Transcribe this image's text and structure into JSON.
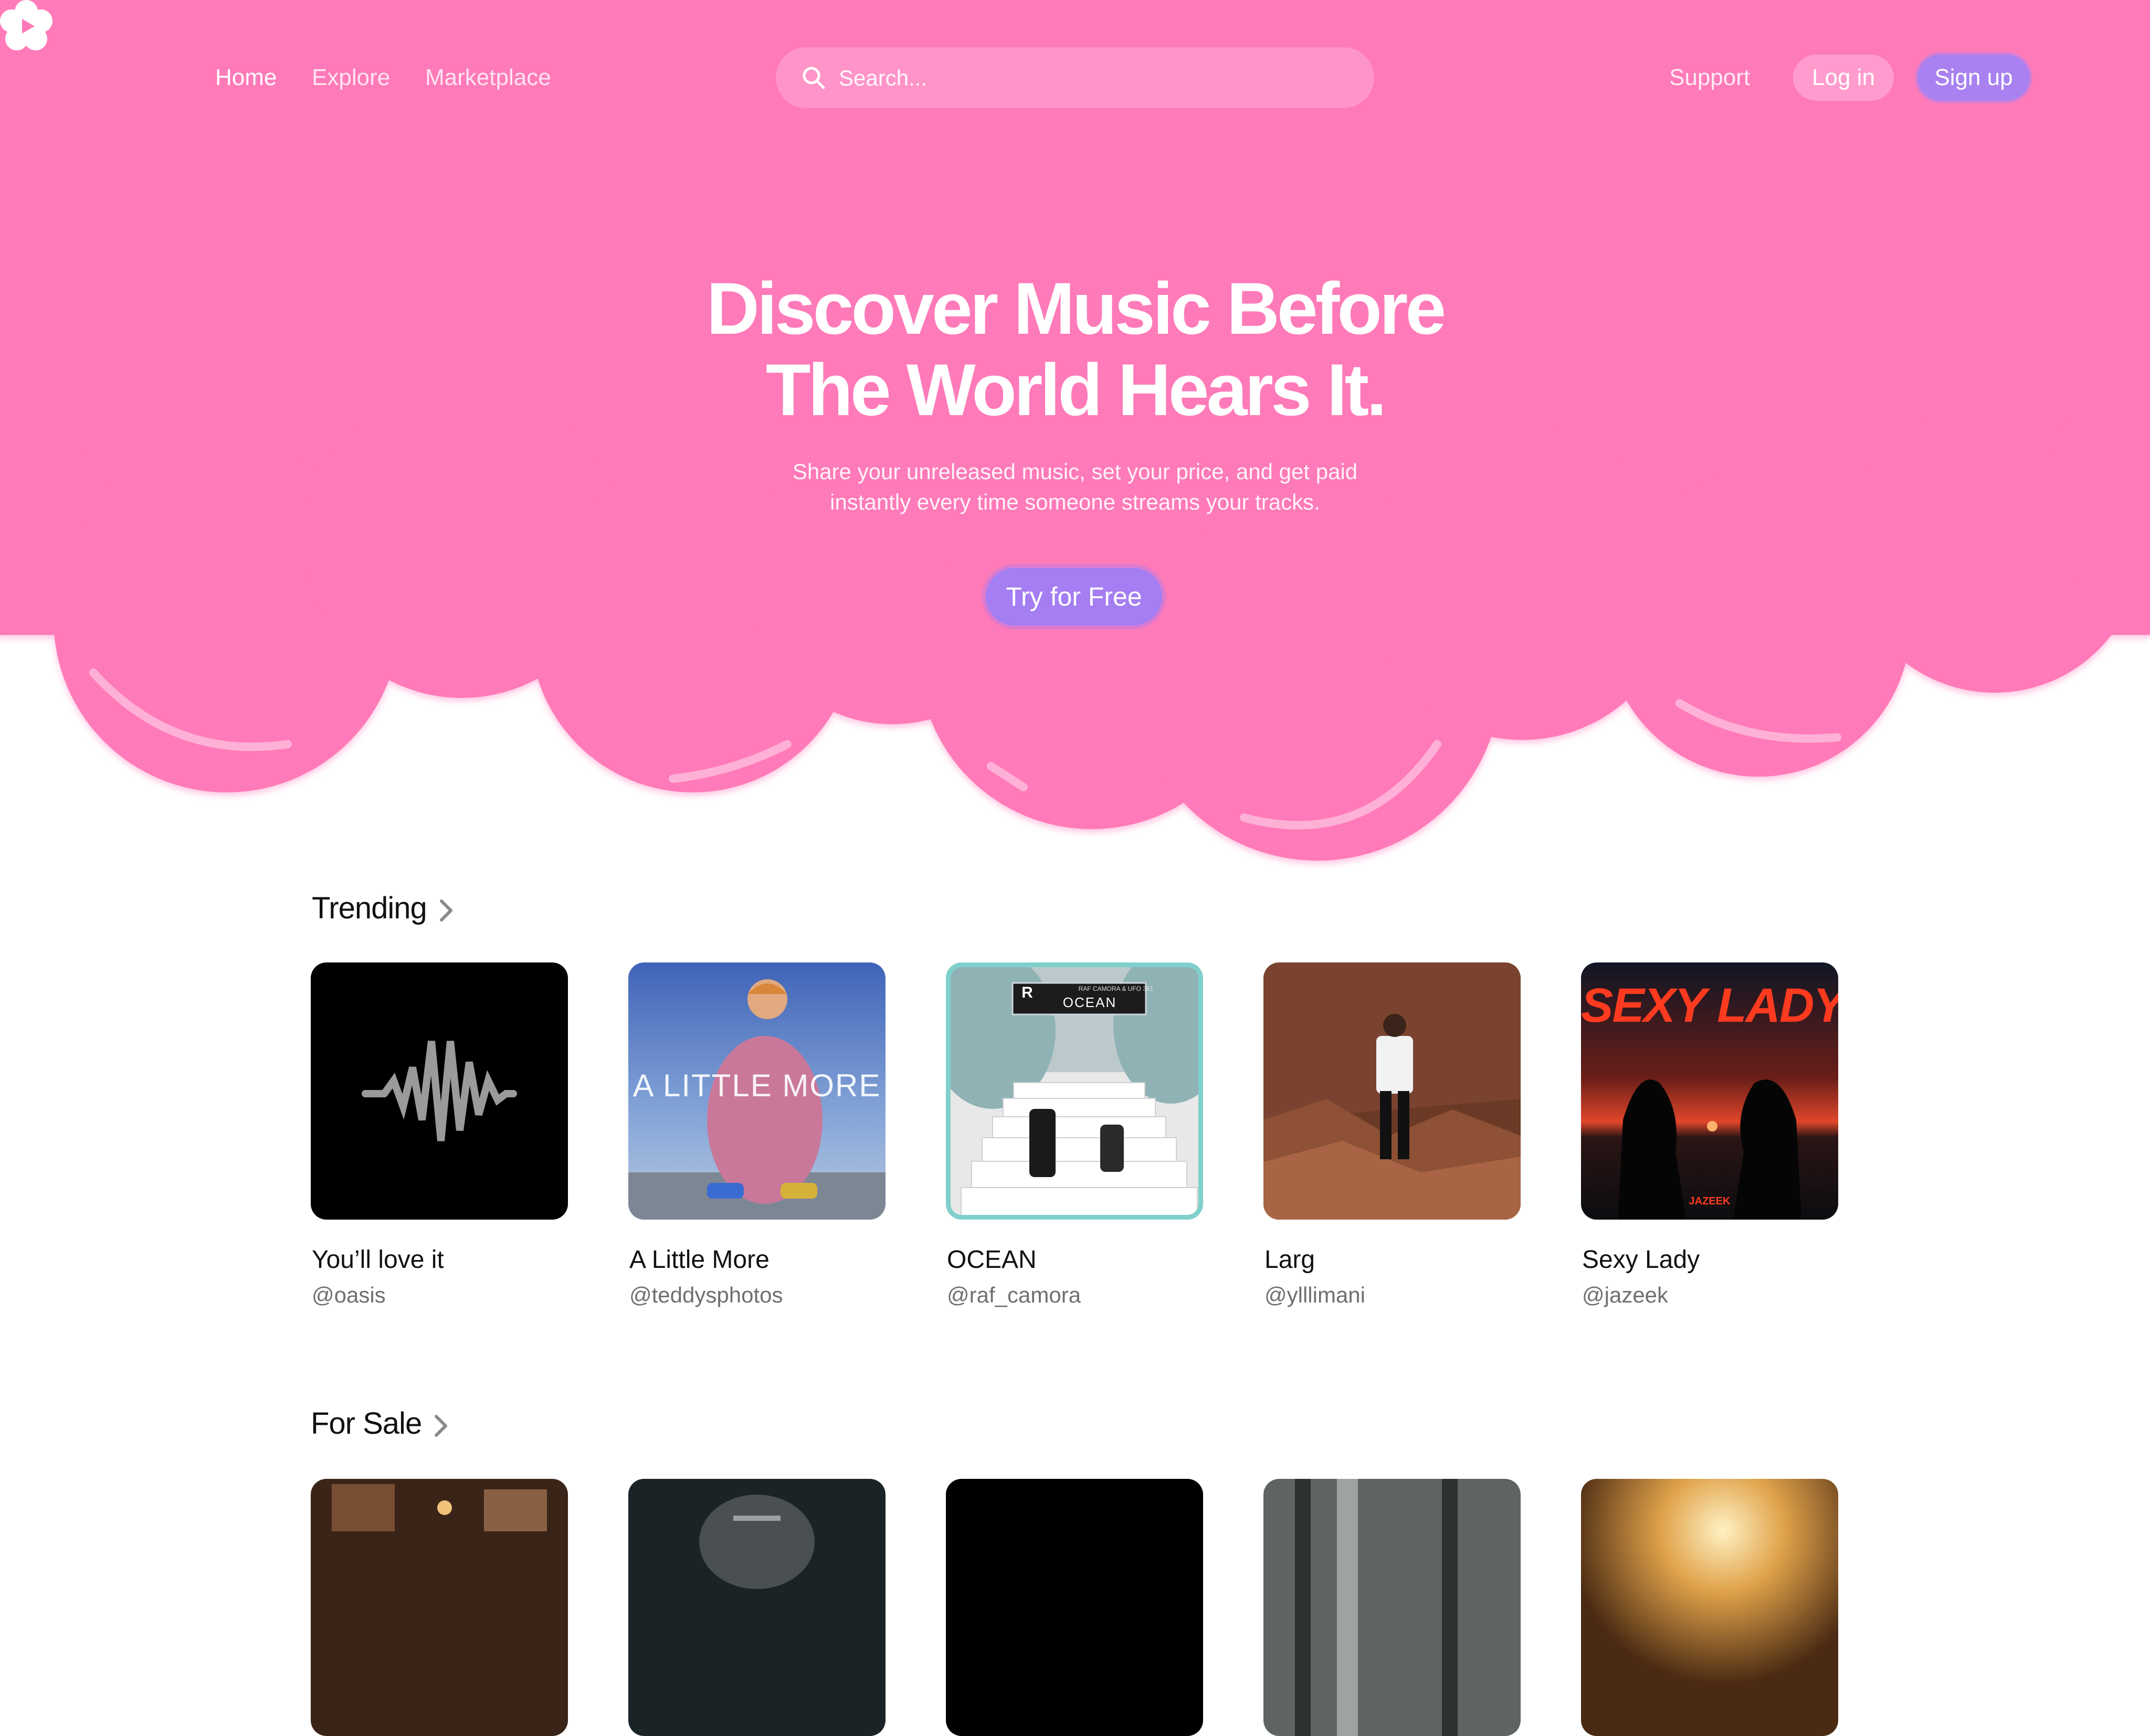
{
  "colors": {
    "hero_pink": "#ff7ab8",
    "accent_purple": "#a981f0",
    "text_dark": "#111111",
    "text_muted": "#6f6f6f"
  },
  "header": {
    "logo_icon": "flower-play-icon",
    "nav": [
      {
        "label": "Home",
        "active": true
      },
      {
        "label": "Explore",
        "active": false
      },
      {
        "label": "Marketplace",
        "active": false
      }
    ],
    "search": {
      "placeholder": "Search...",
      "icon": "search-icon"
    },
    "support_label": "Support",
    "login_label": "Log in",
    "signup_label": "Sign up"
  },
  "hero": {
    "headline_line1": "Discover Music Before",
    "headline_line2": "The World Hears It.",
    "subline_line1": "Share your unreleased music, set your price, and get paid",
    "subline_line2": "instantly every time someone streams your tracks.",
    "cta_label": "Try for Free"
  },
  "trending": {
    "title": "Trending",
    "items": [
      {
        "title": "You’ll love it",
        "handle": "@oasis",
        "art": "waveform-icon"
      },
      {
        "title": "A Little More",
        "handle": "@teddysphotos",
        "art_text": "A LITTLE MORE"
      },
      {
        "title": "OCEAN",
        "handle": "@raf_camora",
        "art_text_top": "RAF CAMORA & UFO 361",
        "art_text_main": "OCEAN",
        "art_badge": "R"
      },
      {
        "title": "Larg",
        "handle": "@ylllimani"
      },
      {
        "title": "Sexy Lady",
        "handle": "@jazeek",
        "art_text": "SEXY LADY",
        "art_text_small": "JAZEEK"
      }
    ]
  },
  "for_sale": {
    "title": "For Sale"
  }
}
